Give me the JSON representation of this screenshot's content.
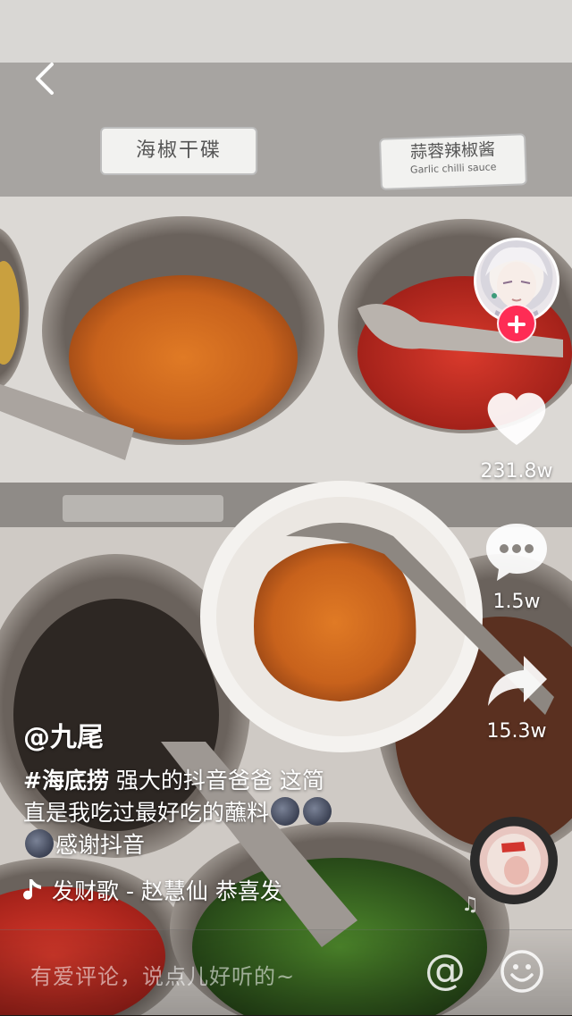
{
  "signs": {
    "left": "海椒干碟",
    "right_zh": "蒜蓉辣椒酱",
    "right_en": "Garlic chilli sauce"
  },
  "sidebar": {
    "like_count": "231.8w",
    "comment_count": "1.5w",
    "share_count": "15.3w"
  },
  "video": {
    "author": "@九尾",
    "hashtag": "#海底捞",
    "caption_line1": " 强大的抖音爸爸 这简",
    "caption_line2": "直是我吃过最好吃的蘸料",
    "caption_line3": "感谢抖音",
    "music": "发财歌 - 赵慧仙    恭喜发"
  },
  "comment_bar": {
    "placeholder": "有爱评论，说点儿好听的~",
    "at_symbol": "@"
  },
  "colors": {
    "follow_badge": "#fe2c55",
    "text": "#ffffff"
  },
  "icons": [
    "back-arrow-icon",
    "plus-icon",
    "heart-icon",
    "comment-bubble-icon",
    "share-arrow-icon",
    "music-note-icon",
    "emoji-face-icon"
  ]
}
